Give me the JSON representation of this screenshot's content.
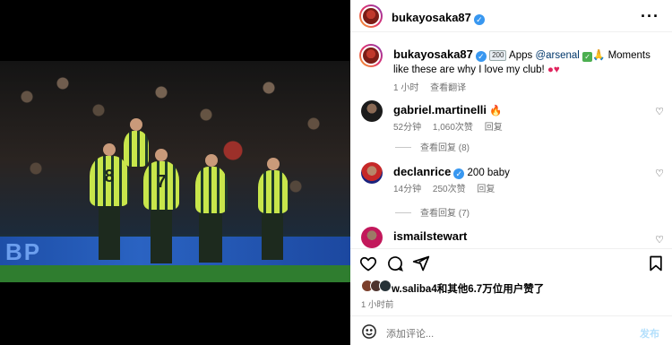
{
  "post": {
    "author": "bukayosaka87",
    "caption_prefix": "",
    "caption_apps_emoji": "200",
    "caption_apps": " Apps ",
    "caption_mention": "@arsenal",
    "caption_rest": " Moments like these are why I love my club! ",
    "time": "1 小时",
    "translate": "查看翻译",
    "more_icon": "more-horizontal-icon"
  },
  "photo": {
    "adboard_text": "BP",
    "player_numbers": [
      "8",
      "7"
    ]
  },
  "comments": [
    {
      "user": "gabriel.martinelli",
      "text": "",
      "emoji": "🔥",
      "time": "52分钟",
      "likes": "1,060次赞",
      "reply": "回复",
      "view_replies": "查看回复 (8)"
    },
    {
      "user": "declanrice",
      "text": "200 baby",
      "emoji": "",
      "time": "14分钟",
      "likes": "250次赞",
      "reply": "回复",
      "view_replies": "查看回复 (7)"
    },
    {
      "user": "ismailstewart",
      "text": "",
      "emoji": "",
      "time": "",
      "likes": "",
      "reply": "",
      "view_replies": ""
    }
  ],
  "likes_summary": {
    "liker": "w.saliba4",
    "rest": "和其他6.7万位用户赞了"
  },
  "post_time": "1 小时前",
  "comment_box": {
    "placeholder": "添加评论...",
    "post_label": "发布"
  },
  "colors": {
    "verified": "#3897f0",
    "link": "#00376b",
    "kit": "#c8e64b"
  }
}
